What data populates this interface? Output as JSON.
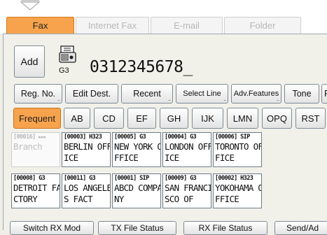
{
  "tabs": [
    {
      "label": "Fax",
      "active": true
    },
    {
      "label": "Internet Fax",
      "active": false
    },
    {
      "label": "E-mail",
      "active": false
    },
    {
      "label": "Folder",
      "active": false
    }
  ],
  "add_button": "Add",
  "line_type": "G3",
  "destination_number": "0312345678_",
  "function_buttons": [
    "Reg. No.",
    "Edit Dest.",
    "Recent",
    "Select Line",
    "Adv.Features",
    "Tone",
    "P"
  ],
  "index_buttons": [
    "Frequent",
    "AB",
    "CD",
    "EF",
    "GH",
    "IJK",
    "LMN",
    "OPQ",
    "RST"
  ],
  "destinations": [
    {
      "id": "[00016]",
      "tag": "",
      "line1": "Branch",
      "line2": "",
      "disabled": true
    },
    {
      "id": "[00003]",
      "tag": "H323",
      "line1": "BERLIN OFF",
      "line2": "ICE",
      "disabled": false
    },
    {
      "id": "[00005]",
      "tag": "G3",
      "line1": "NEW YORK O",
      "line2": "FFICE",
      "disabled": false
    },
    {
      "id": "[00004]",
      "tag": "G3",
      "line1": "LONDON OFF",
      "line2": "ICE",
      "disabled": false
    },
    {
      "id": "[00006]",
      "tag": "SIP",
      "line1": "TORONTO OF",
      "line2": "FICE",
      "disabled": false
    },
    {
      "id": "[00008]",
      "tag": "G3",
      "line1": "DETROIT FA",
      "line2": "CTORY",
      "disabled": false
    },
    {
      "id": "[00011]",
      "tag": "G3",
      "line1": "LOS ANGELE",
      "line2": "S FACT",
      "disabled": false
    },
    {
      "id": "[00001]",
      "tag": "SIP",
      "line1": "ABCD COMPA",
      "line2": "NY",
      "disabled": false
    },
    {
      "id": "[00009]",
      "tag": "G3",
      "line1": "SAN FRANCI",
      "line2": "SCO OF",
      "disabled": false
    },
    {
      "id": "[00002]",
      "tag": "H323",
      "line1": "YOKOHAMA O",
      "line2": "FFICE",
      "disabled": false
    }
  ],
  "bottom_buttons": [
    "Switch RX Mod",
    "TX File Status",
    "RX File Status",
    "Send/Ad"
  ],
  "colors": {
    "accent": "#f7a34d",
    "border": "#7c8a97"
  }
}
